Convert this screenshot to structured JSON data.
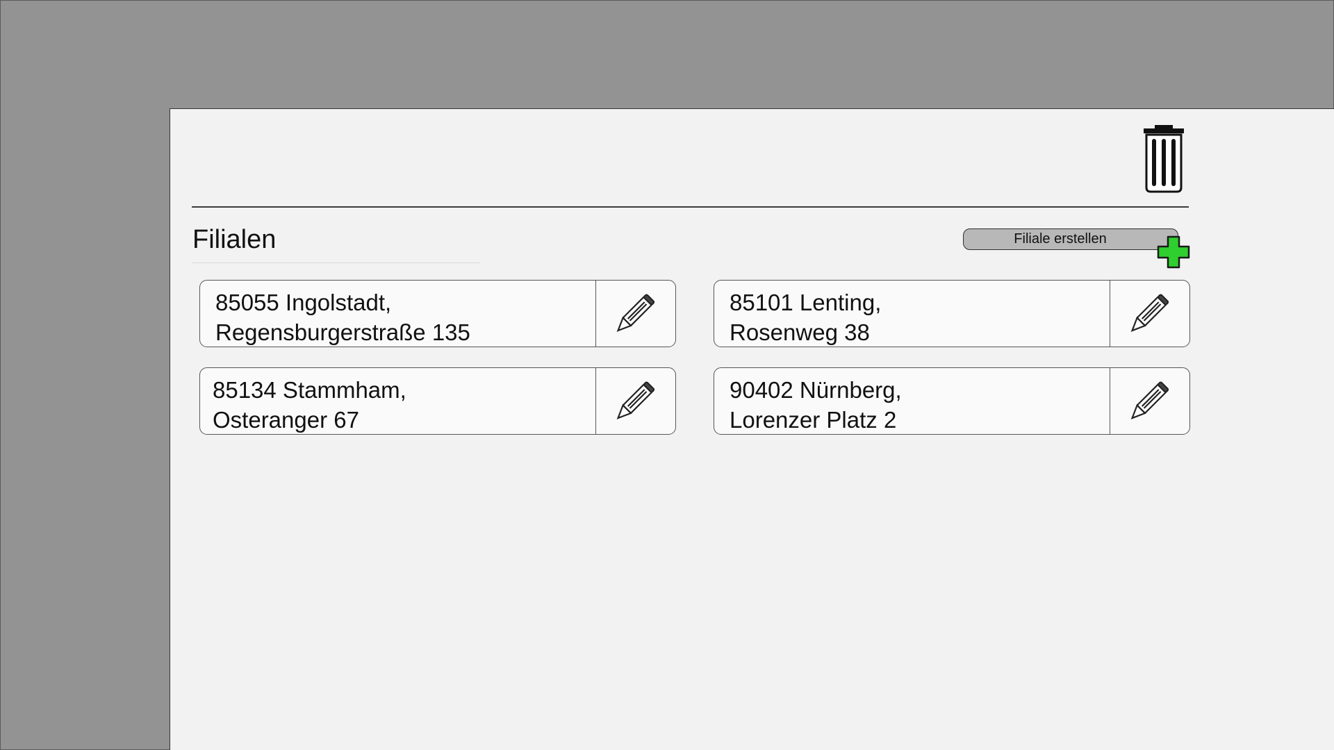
{
  "page": {
    "title": "Filialen",
    "create_button_label": "Filiale erstellen",
    "icons": {
      "trash": "trash-icon",
      "add": "plus-icon",
      "edit": "pencil-icon"
    },
    "colors": {
      "background": "#939393",
      "panel": "#f2f2f2",
      "accent_add": "#2fcf2f"
    }
  },
  "branches": [
    {
      "line1": "85055 Ingolstadt,",
      "line2": "Regensburgerstraße 135"
    },
    {
      "line1": "85101 Lenting,",
      "line2": "Rosenweg 38"
    },
    {
      "line1": "85134 Stammham,",
      "line2": "Osteranger 67"
    },
    {
      "line1": "90402 Nürnberg,",
      "line2": "Lorenzer Platz 2"
    }
  ]
}
